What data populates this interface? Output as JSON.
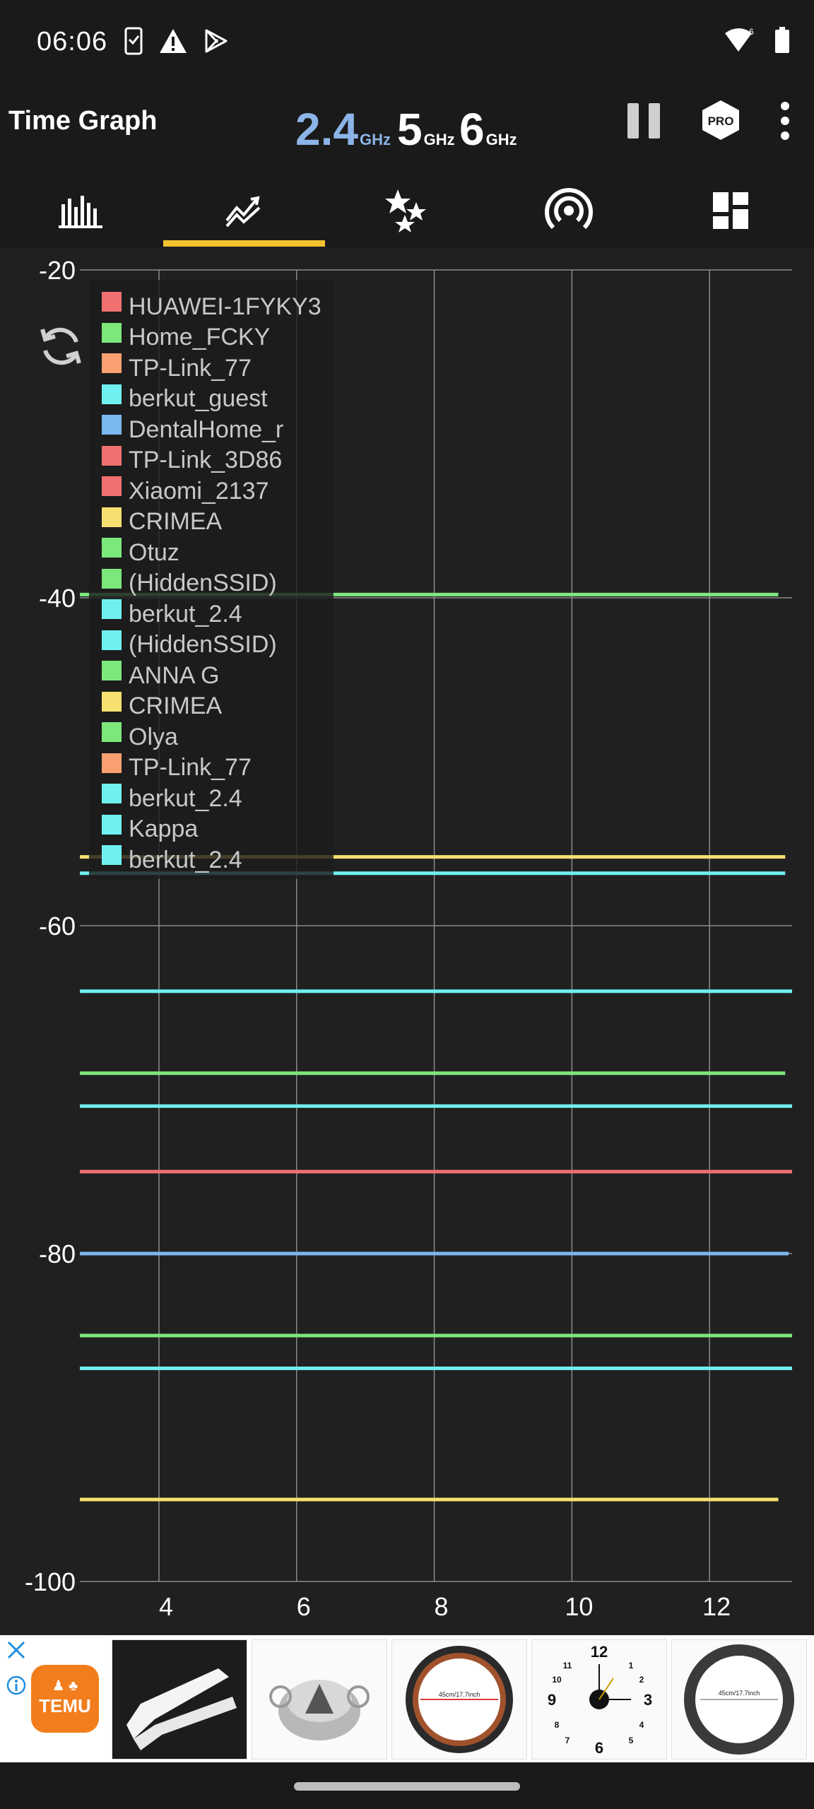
{
  "status_bar": {
    "time": "06:06",
    "icons_left": [
      "sim-card-icon",
      "warning-icon",
      "play-store-icon"
    ],
    "icons_right": [
      "wifi-6-icon",
      "battery-icon"
    ],
    "wifi_badge": "6"
  },
  "app_bar": {
    "title": "Time Graph",
    "bands": [
      {
        "num": "2.4",
        "unit": "GHz",
        "active": true
      },
      {
        "num": "5",
        "unit": "GHz",
        "active": false
      },
      {
        "num": "6",
        "unit": "GHz",
        "active": false
      }
    ],
    "pro_label": "PRO",
    "actions": [
      "pause-icon",
      "pro-icon",
      "more-vert-icon"
    ]
  },
  "tabs": [
    {
      "name": "channel-graph",
      "icon": "bar-chart-icon",
      "selected": false
    },
    {
      "name": "time-graph",
      "icon": "trend-line-icon",
      "selected": true
    },
    {
      "name": "channel-rating",
      "icon": "stars-icon",
      "selected": false
    },
    {
      "name": "access-points",
      "icon": "signal-icon",
      "selected": false
    },
    {
      "name": "vendors",
      "icon": "dashboard-icon",
      "selected": false
    }
  ],
  "chart_data": {
    "type": "line",
    "title": "",
    "xlabel": "",
    "ylabel": "",
    "xlim": [
      2.85,
      13.2
    ],
    "ylim": [
      -100,
      -20
    ],
    "x_ticks": [
      4,
      6,
      8,
      10,
      12
    ],
    "y_ticks": [
      -20,
      -40,
      -60,
      -80,
      -100
    ],
    "grid": true,
    "legend_position": "top-left",
    "legend": [
      {
        "name": "HUAWEI-1FYKY3",
        "color": "#f07070"
      },
      {
        "name": "Home_FCKY",
        "color": "#7ce87c"
      },
      {
        "name": "TP-Link_77",
        "color": "#f8a070"
      },
      {
        "name": "berkut_guest",
        "color": "#70f0f0"
      },
      {
        "name": "DentalHome_r",
        "color": "#7ab8f0"
      },
      {
        "name": "TP-Link_3D86",
        "color": "#f07070"
      },
      {
        "name": "Xiaomi_2137",
        "color": "#f07070"
      },
      {
        "name": "CRIMEA",
        "color": "#f8e070"
      },
      {
        "name": "Otuz",
        "color": "#7ce87c"
      },
      {
        "name": "(HiddenSSID)",
        "color": "#7ce87c"
      },
      {
        "name": "berkut_2.4",
        "color": "#70f0f0"
      },
      {
        "name": "(HiddenSSID)",
        "color": "#70f0f0"
      },
      {
        "name": "ANNA G",
        "color": "#7ce87c"
      },
      {
        "name": "CRIMEA",
        "color": "#f8e070"
      },
      {
        "name": "Olya",
        "color": "#7ce87c"
      },
      {
        "name": "TP-Link_77",
        "color": "#f8a070"
      },
      {
        "name": "berkut_2.4",
        "color": "#70f0f0"
      },
      {
        "name": "Kappa",
        "color": "#70f0f0"
      },
      {
        "name": "berkut_2.4",
        "color": "#70f0f0"
      }
    ],
    "series": [
      {
        "color": "#7ce87c",
        "x": [
          2.85,
          13.0
        ],
        "y": [
          -39.8,
          -39.8
        ]
      },
      {
        "color": "#f8e070",
        "x": [
          2.85,
          13.1
        ],
        "y": [
          -55.8,
          -55.8
        ]
      },
      {
        "color": "#70f0f0",
        "x": [
          2.85,
          13.1
        ],
        "y": [
          -56.8,
          -56.8
        ]
      },
      {
        "color": "#70f0f0",
        "x": [
          2.85,
          13.2
        ],
        "y": [
          -64.0,
          -64.0
        ]
      },
      {
        "color": "#7ce87c",
        "x": [
          2.85,
          13.1
        ],
        "y": [
          -69.0,
          -69.0
        ]
      },
      {
        "color": "#70f0f0",
        "x": [
          2.85,
          13.2
        ],
        "y": [
          -71.0,
          -71.0
        ]
      },
      {
        "color": "#f07070",
        "x": [
          2.85,
          13.2
        ],
        "y": [
          -75.0,
          -75.0
        ]
      },
      {
        "color": "#7ab8f0",
        "x": [
          2.85,
          13.15
        ],
        "y": [
          -80.0,
          -80.0
        ]
      },
      {
        "color": "#7ce87c",
        "x": [
          2.85,
          13.2
        ],
        "y": [
          -85.0,
          -85.0
        ]
      },
      {
        "color": "#70f0f0",
        "x": [
          2.85,
          13.2
        ],
        "y": [
          -87.0,
          -87.0
        ]
      },
      {
        "color": "#f8e070",
        "x": [
          2.85,
          13.0
        ],
        "y": [
          -95.0,
          -95.0
        ]
      }
    ]
  },
  "ad": {
    "brand": "TEMU",
    "products": [
      "white-gloves",
      "silver-weight",
      "brown-steering-cover",
      "wall-clock",
      "black-steering-cover"
    ],
    "product_caption": "45cm/17.7inch",
    "close_icon": "close-icon",
    "info_icon": "info-icon"
  },
  "colors": {
    "accent_tab": "#f4c430",
    "active_band": "#8cb4e8",
    "chart_bg": "#202020",
    "grid": "#8a8a8a"
  }
}
